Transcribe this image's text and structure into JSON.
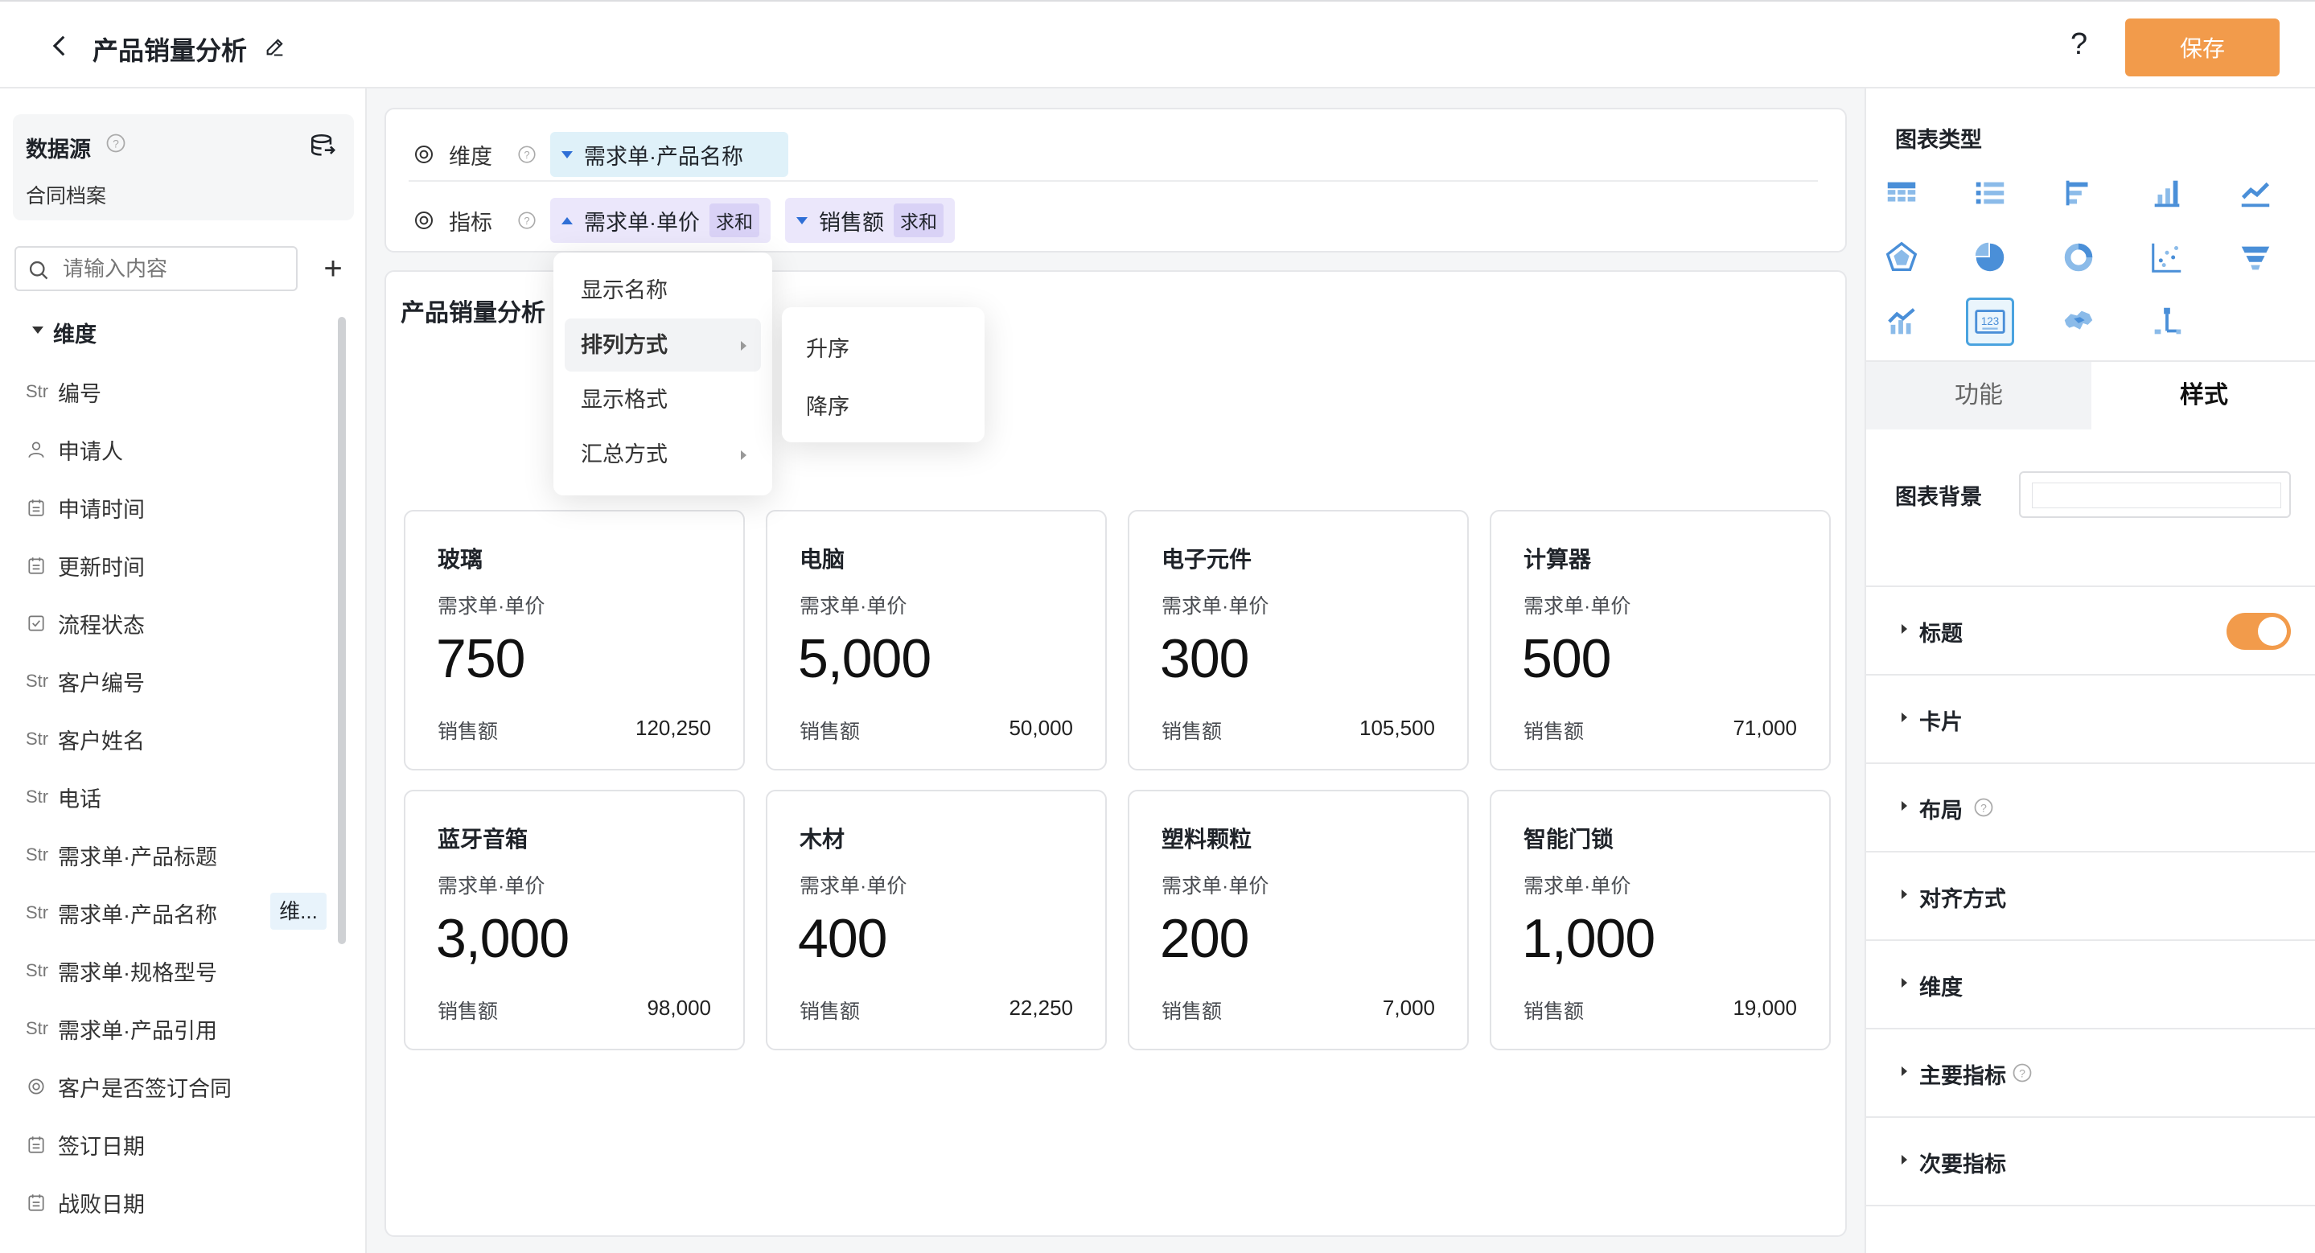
{
  "header": {
    "title": "产品销量分析",
    "help": "?",
    "save_label": "保存"
  },
  "sidebar": {
    "datasource_title": "数据源",
    "datasource_name": "合同档案",
    "search_placeholder": "请输入内容",
    "add": "+",
    "group_label": "维度",
    "fields": [
      {
        "type": "Str",
        "label": "编号"
      },
      {
        "type": "user",
        "label": "申请人"
      },
      {
        "type": "date",
        "label": "申请时间"
      },
      {
        "type": "date",
        "label": "更新时间"
      },
      {
        "type": "check",
        "label": "流程状态"
      },
      {
        "type": "Str",
        "label": "客户编号"
      },
      {
        "type": "Str",
        "label": "客户姓名"
      },
      {
        "type": "Str",
        "label": "电话"
      },
      {
        "type": "Str",
        "label": "需求单·产品标题"
      },
      {
        "type": "Str",
        "label": "需求单·产品名称"
      },
      {
        "type": "Str",
        "label": "需求单·规格型号"
      },
      {
        "type": "Str",
        "label": "需求单·产品引用"
      },
      {
        "type": "radio",
        "label": "客户是否签订合同"
      },
      {
        "type": "date",
        "label": "签订日期"
      },
      {
        "type": "date",
        "label": "战败日期"
      }
    ],
    "dim_tag": "维..."
  },
  "config": {
    "dimension_label": "维度",
    "metric_label": "指标",
    "dimension_pill": "需求单·产品名称",
    "metric_pills": [
      {
        "label": "需求单·单价",
        "agg": "求和"
      },
      {
        "label": "销售额",
        "agg": "求和"
      }
    ]
  },
  "panel": {
    "title": "产品销量分析",
    "cards": [
      {
        "name": "玻璃",
        "metric": "需求单·单价",
        "value": "750",
        "sec_label": "销售额",
        "sec_value": "120,250"
      },
      {
        "name": "电脑",
        "metric": "需求单·单价",
        "value": "5,000",
        "sec_label": "销售额",
        "sec_value": "50,000"
      },
      {
        "name": "电子元件",
        "metric": "需求单·单价",
        "value": "300",
        "sec_label": "销售额",
        "sec_value": "105,500"
      },
      {
        "name": "计算器",
        "metric": "需求单·单价",
        "value": "500",
        "sec_label": "销售额",
        "sec_value": "71,000"
      },
      {
        "name": "蓝牙音箱",
        "metric": "需求单·单价",
        "value": "3,000",
        "sec_label": "销售额",
        "sec_value": "98,000"
      },
      {
        "name": "木材",
        "metric": "需求单·单价",
        "value": "400",
        "sec_label": "销售额",
        "sec_value": "22,250"
      },
      {
        "name": "塑料颗粒",
        "metric": "需求单·单价",
        "value": "200",
        "sec_label": "销售额",
        "sec_value": "7,000"
      },
      {
        "name": "智能门锁",
        "metric": "需求单·单价",
        "value": "1,000",
        "sec_label": "销售额",
        "sec_value": "19,000"
      }
    ]
  },
  "menu": {
    "items": [
      "显示名称",
      "排列方式",
      "显示格式",
      "汇总方式"
    ],
    "active_item": "排列方式",
    "submenu": [
      "升序",
      "降序"
    ]
  },
  "right": {
    "chart_type_title": "图表类型",
    "chart_types": [
      "table-icon",
      "list-icon",
      "bar-horizontal-icon",
      "bar-vertical-icon",
      "line-icon",
      "radar-icon",
      "pie-icon",
      "donut-icon",
      "scatter-icon",
      "funnel-icon",
      "combo-icon",
      "indicator-card-icon",
      "map-icon",
      "tree-icon"
    ],
    "selected_type": "indicator-card-icon",
    "tabs": [
      "功能",
      "样式"
    ],
    "active_tab": "样式",
    "bg_label": "图表背景",
    "sections": [
      "标题",
      "卡片",
      "布局",
      "对齐方式",
      "维度",
      "主要指标",
      "次要指标"
    ],
    "title_toggle_on": true,
    "accent": "#f29b4b",
    "select_color": "#4aa3df"
  }
}
